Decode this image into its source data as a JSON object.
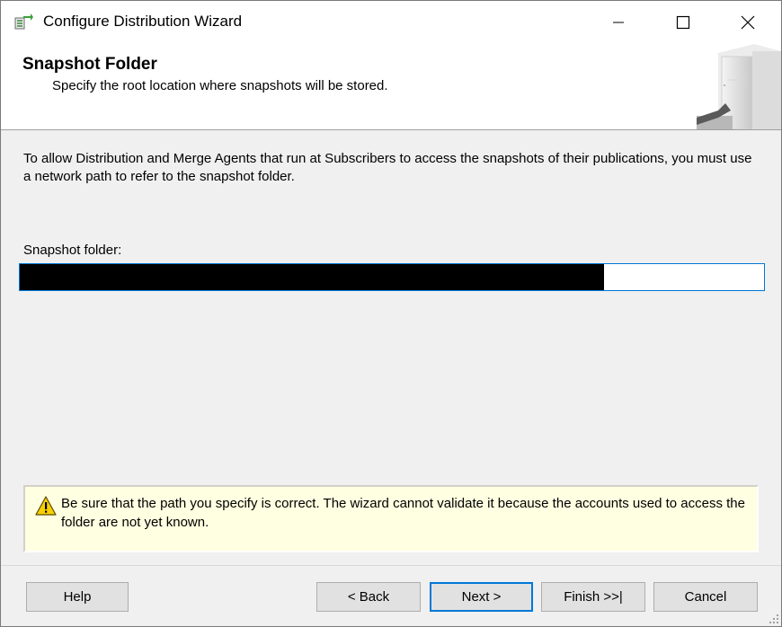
{
  "window": {
    "title": "Configure Distribution Wizard"
  },
  "header": {
    "title": "Snapshot Folder",
    "subtitle": "Specify the root location where snapshots will be stored."
  },
  "main": {
    "intro": "To allow Distribution and Merge Agents that run at Subscribers to access the snapshots of their publications, you must use a network path to refer to the snapshot folder.",
    "folder_label": "Snapshot folder:",
    "folder_value": ""
  },
  "warning": {
    "text": "Be sure that the path you specify is correct. The wizard cannot validate it because the accounts used to access the folder are not yet known.",
    "icon": "warning-icon"
  },
  "footer": {
    "help": "Help",
    "back": "< Back",
    "next": "Next >",
    "finish": "Finish >>|",
    "cancel": "Cancel"
  },
  "colors": {
    "accent": "#0078d7",
    "warning_bg": "#ffffe1",
    "button_bg": "#e1e1e1"
  }
}
